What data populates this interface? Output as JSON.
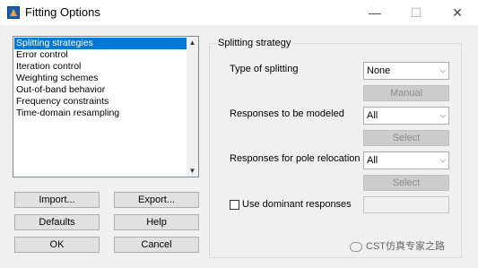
{
  "window": {
    "title": "Fitting Options",
    "min_glyph": "—",
    "max_glyph": "☐",
    "close_glyph": "✕"
  },
  "list": {
    "items": [
      "Splitting strategies",
      "Error control",
      "Iteration control",
      "Weighting schemes",
      "Out-of-band behavior",
      "Frequency constraints",
      "Time-domain resampling"
    ],
    "selected_index": 0,
    "scroll_up": "▲",
    "scroll_down": "▼"
  },
  "buttons": {
    "import": "Import...",
    "export": "Export...",
    "defaults": "Defaults",
    "help": "Help",
    "ok": "OK",
    "cancel": "Cancel"
  },
  "group": {
    "title": "Splitting strategy",
    "type_of_splitting": {
      "label": "Type of splitting",
      "value": "None",
      "button": "Manual"
    },
    "responses_modeled": {
      "label": "Responses to be modeled",
      "value": "All",
      "button": "Select"
    },
    "pole_relocation": {
      "label": "Responses for pole relocation",
      "value": "All",
      "button": "Select"
    },
    "dominant": {
      "label": "Use dominant responses",
      "checked": false,
      "value": ""
    },
    "dropdown_glyph": "⌵"
  },
  "watermark": {
    "text": "CST仿真专家之路"
  }
}
